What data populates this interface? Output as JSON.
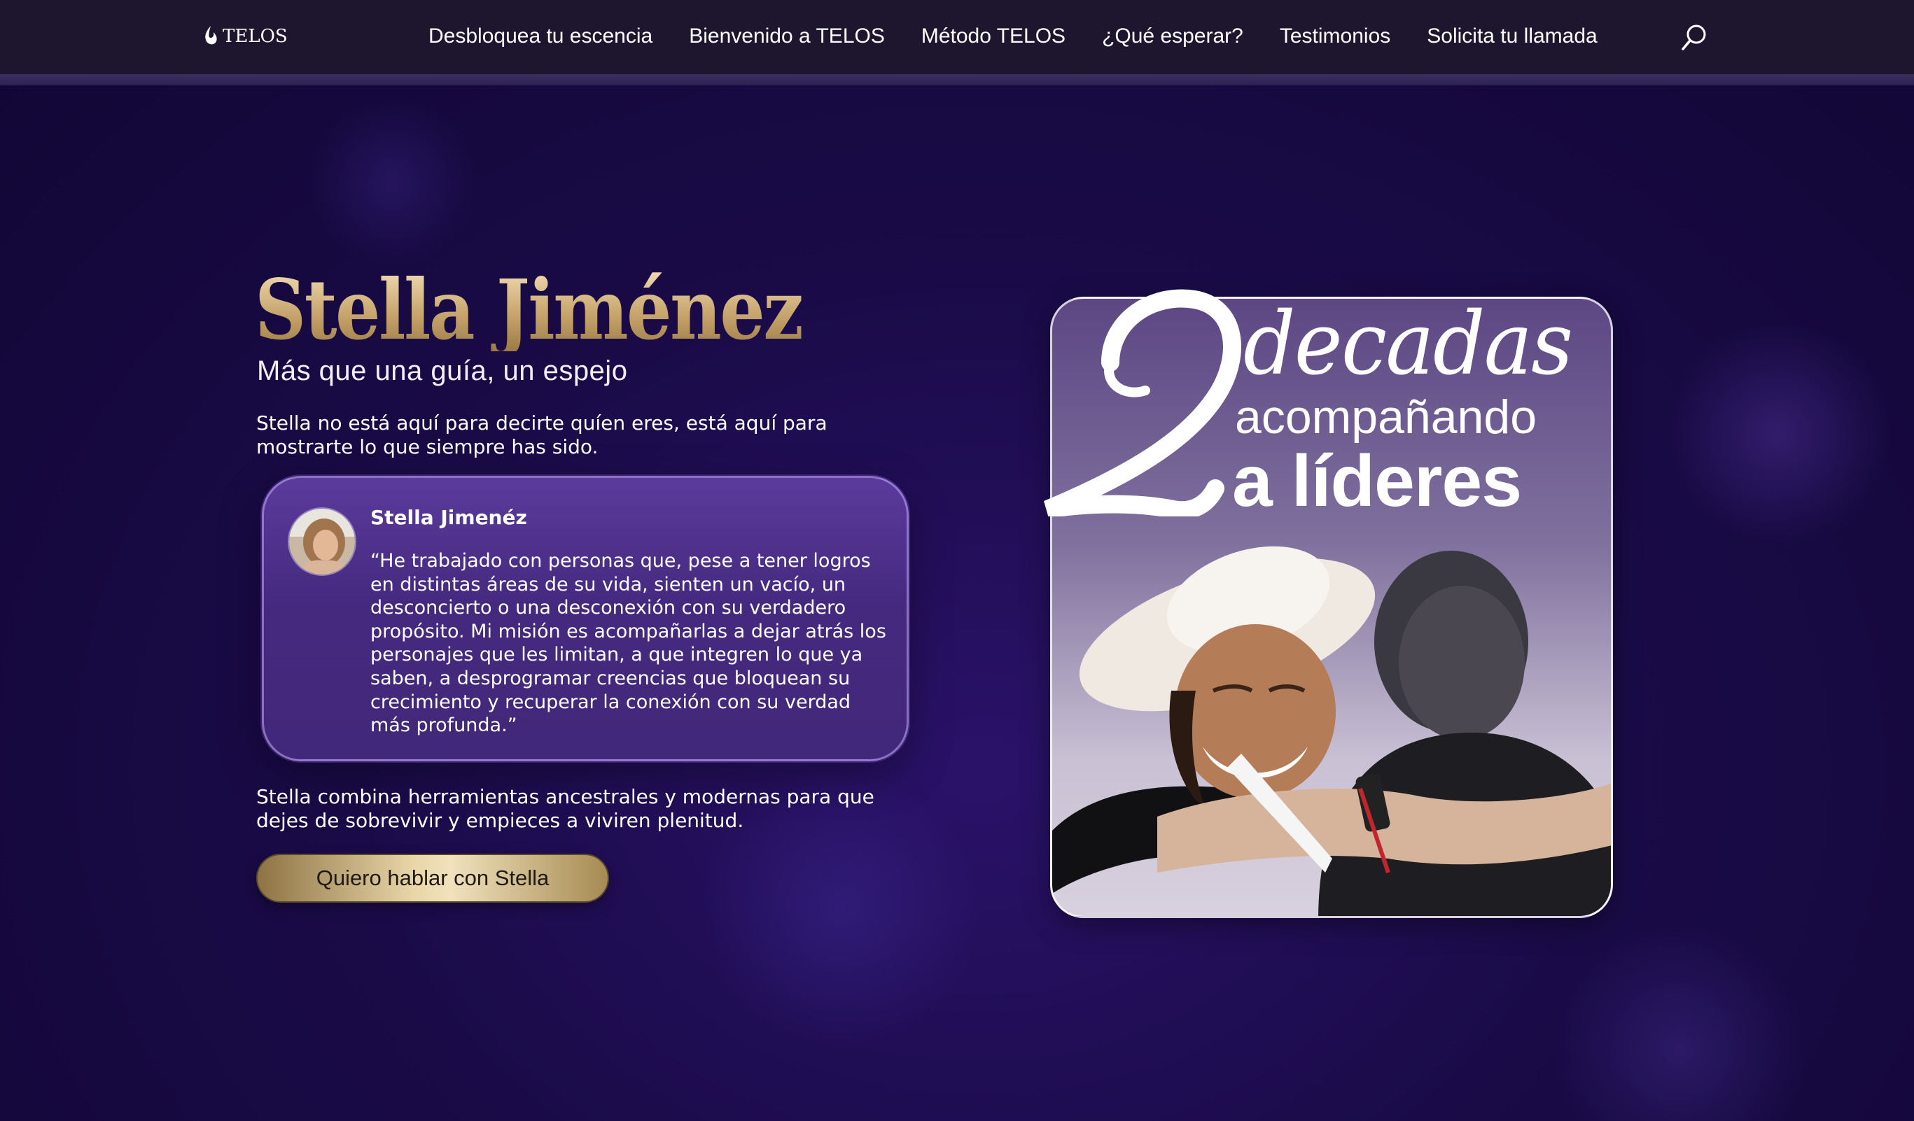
{
  "header": {
    "logo_text": "TELOS",
    "nav": [
      "Desbloquea tu escencia",
      "Bienvenido a TELOS",
      "Método TELOS",
      "¿Qué esperar?",
      "Testimonios",
      "Solicita tu llamada"
    ],
    "search_icon": "search-icon"
  },
  "hero": {
    "title": "Stella Jiménez",
    "subtitle": "Más que una guía, un espejo",
    "intro": "Stella no está aquí para decirte quíen eres, está aquí para mostrarte lo que siempre has sido.",
    "quote": {
      "name": "Stella Jimenéz",
      "text": "“He trabajado con personas que, pese a tener logros en distintas áreas de su vida, sienten un vacío, un desconcierto o una desconexión con su verdadero propósito. Mi misión es acompañarlas a dejar atrás los personajes que les limitan, a que integren lo que ya saben, a desprogramar creencias que bloquean su crecimiento y recuperar la conexión con su verdad más profunda.”"
    },
    "closing": "Stella combina herramientas ancestrales y modernas para que dejes de sobrevivir y empieces a viviren plenitud.",
    "cta_label": "Quiero hablar con Stella"
  },
  "promo": {
    "number": "2",
    "line1": "decadas",
    "line2": "acompañando",
    "line3": "a líderes"
  },
  "colors": {
    "nav_bg": "#1e162f",
    "page_bg": "#1a0b48",
    "gold": "#c7a56c",
    "card_bg": "#4a2d86"
  }
}
